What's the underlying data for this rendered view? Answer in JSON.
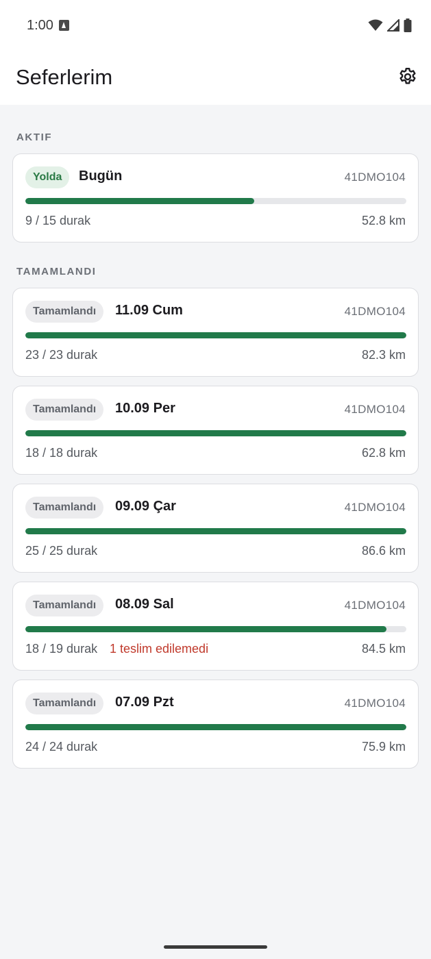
{
  "status_bar": {
    "time": "1:00",
    "icons": [
      "a-notification-icon",
      "wifi-icon",
      "signal-icon",
      "battery-icon"
    ]
  },
  "app_bar": {
    "title": "Seferlerim",
    "settings_icon": "gear-icon"
  },
  "sections": {
    "active_label": "AKTIF",
    "completed_label": "TAMAMLANDI"
  },
  "colors": {
    "accent": "#217a4a",
    "active_chip_bg": "#e3f1e7",
    "active_chip_text": "#2a7a45",
    "warning": "#c0392b"
  },
  "active_trip": {
    "status": "Yolda",
    "date": "Bugün",
    "plate": "41DMO104",
    "stops": "9 / 15 durak",
    "distance": "52.8 km",
    "progress": 0.6
  },
  "completed_trips": [
    {
      "status": "Tamamlandı",
      "date": "11.09 Cum",
      "plate": "41DMO104",
      "stops": "23 / 23 durak",
      "warning": "",
      "distance": "82.3 km",
      "progress": 1.0
    },
    {
      "status": "Tamamlandı",
      "date": "10.09 Per",
      "plate": "41DMO104",
      "stops": "18 / 18 durak",
      "warning": "",
      "distance": "62.8 km",
      "progress": 1.0
    },
    {
      "status": "Tamamlandı",
      "date": "09.09 Çar",
      "plate": "41DMO104",
      "stops": "25 / 25 durak",
      "warning": "",
      "distance": "86.6 km",
      "progress": 1.0
    },
    {
      "status": "Tamamlandı",
      "date": "08.09 Sal",
      "plate": "41DMO104",
      "stops": "18 / 19 durak",
      "warning": "1 teslim edilemedi",
      "distance": "84.5 km",
      "progress": 0.947
    },
    {
      "status": "Tamamlandı",
      "date": "07.09 Pzt",
      "plate": "41DMO104",
      "stops": "24 / 24 durak",
      "warning": "",
      "distance": "75.9 km",
      "progress": 1.0
    }
  ]
}
